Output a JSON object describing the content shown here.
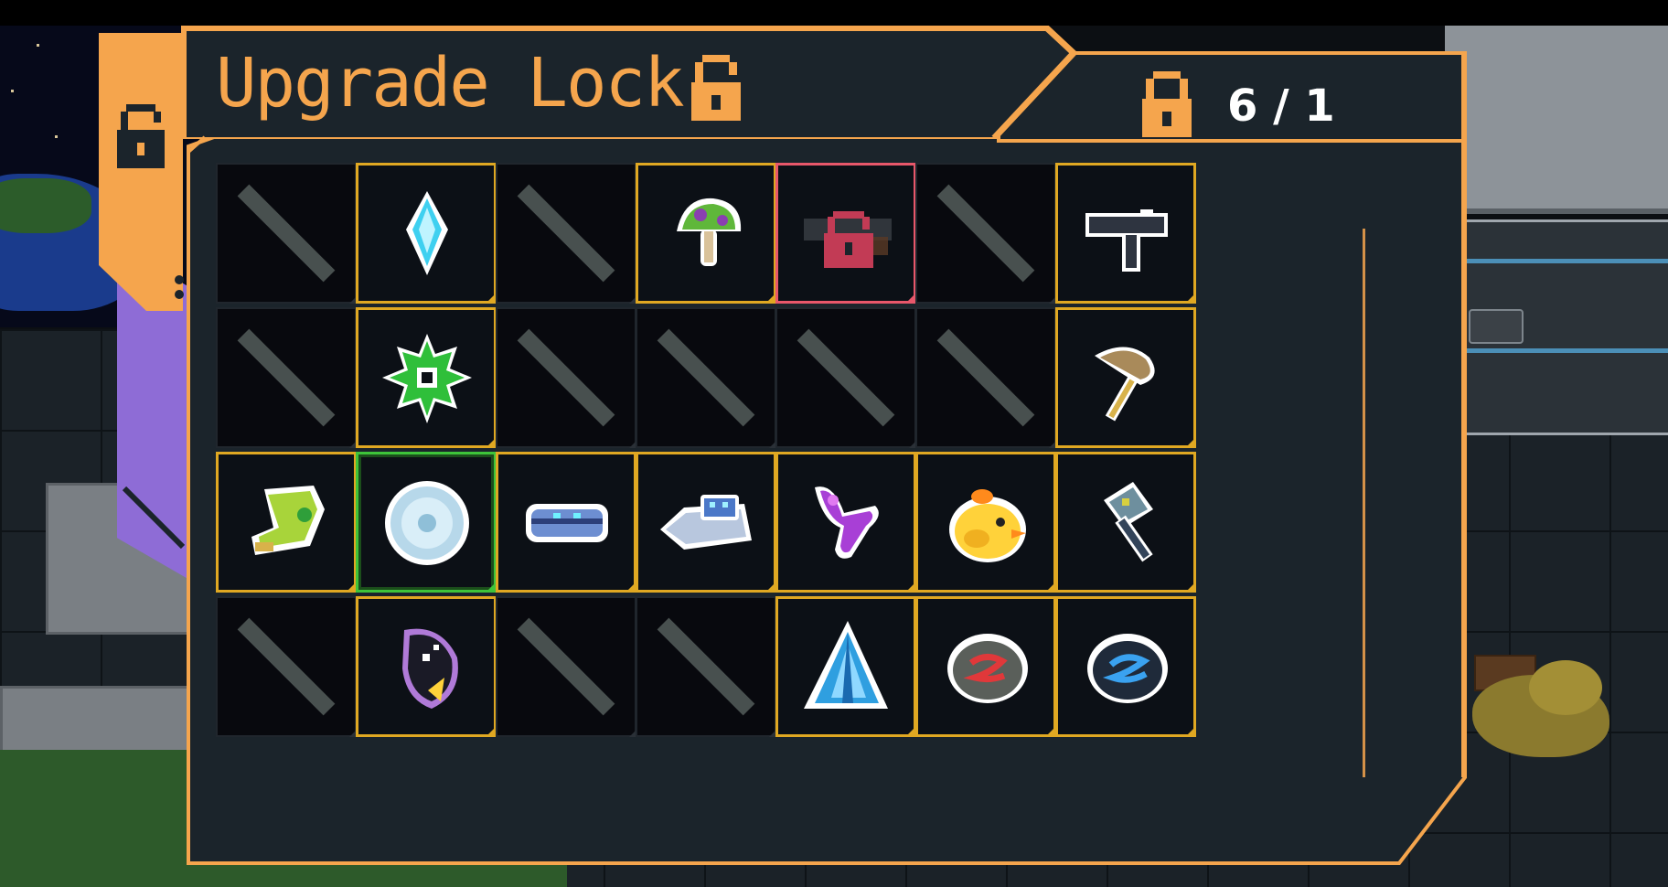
{
  "title": "Upgrade Lock",
  "lock_count": "6 / 1",
  "colors": {
    "accent": "#f5a54d",
    "panel_bg": "#1b242b",
    "slot_gold": "#e0a822",
    "slot_green": "#3ec43a",
    "slot_locked": "#e8576a"
  },
  "slots": [
    {
      "state": "empty",
      "item": ""
    },
    {
      "state": "gold",
      "item": "ice-crystal-icon"
    },
    {
      "state": "empty",
      "item": ""
    },
    {
      "state": "gold",
      "item": "mushroom-icon"
    },
    {
      "state": "locked",
      "item": "locked-rifle-icon"
    },
    {
      "state": "empty",
      "item": ""
    },
    {
      "state": "gold",
      "item": "uzi-icon"
    },
    {
      "state": "empty",
      "item": ""
    },
    {
      "state": "gold",
      "item": "spiked-gear-icon"
    },
    {
      "state": "empty",
      "item": ""
    },
    {
      "state": "empty",
      "item": ""
    },
    {
      "state": "empty",
      "item": ""
    },
    {
      "state": "empty",
      "item": ""
    },
    {
      "state": "gold",
      "item": "battle-axe-icon"
    },
    {
      "state": "gold",
      "item": "green-boot-icon"
    },
    {
      "state": "green",
      "item": "ice-disc-icon"
    },
    {
      "state": "gold",
      "item": "blue-visor-icon"
    },
    {
      "state": "gold",
      "item": "hover-tank-icon"
    },
    {
      "state": "gold",
      "item": "purple-slingshot-icon"
    },
    {
      "state": "gold",
      "item": "yellow-chick-icon"
    },
    {
      "state": "gold",
      "item": "war-hammer-icon"
    },
    {
      "state": "empty",
      "item": ""
    },
    {
      "state": "gold",
      "item": "shadow-gem-icon"
    },
    {
      "state": "empty",
      "item": ""
    },
    {
      "state": "empty",
      "item": ""
    },
    {
      "state": "gold",
      "item": "blue-crystal-shard-icon"
    },
    {
      "state": "gold",
      "item": "fire-rune-stone-icon"
    },
    {
      "state": "gold",
      "item": "water-rune-stone-icon"
    }
  ]
}
